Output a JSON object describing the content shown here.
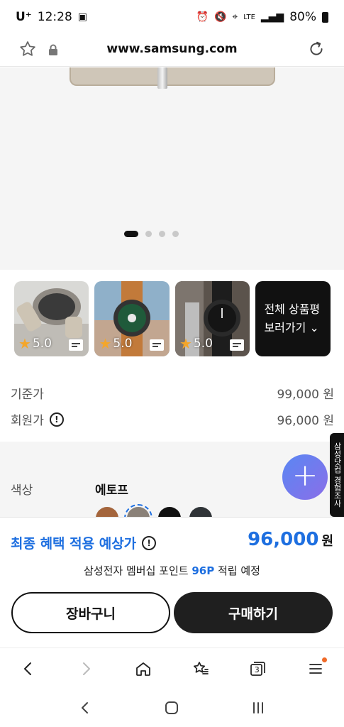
{
  "status_bar": {
    "carrier": "U⁺",
    "time": "12:28",
    "network": "LTE",
    "battery": "80%"
  },
  "url_bar": {
    "url": "www.samsung.com"
  },
  "hero": {
    "carousel_total": 4,
    "carousel_active": 1
  },
  "reviews": {
    "items": [
      {
        "rating": "5.0"
      },
      {
        "rating": "5.0"
      },
      {
        "rating": "5.0"
      }
    ],
    "view_all_line1": "전체 상품평",
    "view_all_line2": "보러가기 ⌄"
  },
  "price": {
    "standard_label": "기준가",
    "standard_value": "99,000 원",
    "member_label": "회원가",
    "member_value": "96,000 원"
  },
  "color": {
    "label": "색상",
    "selected": "에토프",
    "swatches": [
      "#a4653c",
      "#8a8178",
      "#111111",
      "#2f3337"
    ]
  },
  "side_tab": {
    "label": "삼성닷컴 경험조사"
  },
  "sheet": {
    "benefit_label": "최종 혜택 적용 예상가",
    "benefit_price": "96,000",
    "benefit_unit": "원",
    "points_prefix": "삼성전자 멤버십 포인트",
    "points_value": "96P",
    "points_suffix": "적립 예정",
    "cart_button": "장바구니",
    "buy_button": "구매하기"
  },
  "browser_nav": {
    "tabs_count": "3"
  },
  "colors": {
    "accent": "#1e6fe0",
    "dark": "#1f1f1f",
    "notify": "#f06a28"
  }
}
